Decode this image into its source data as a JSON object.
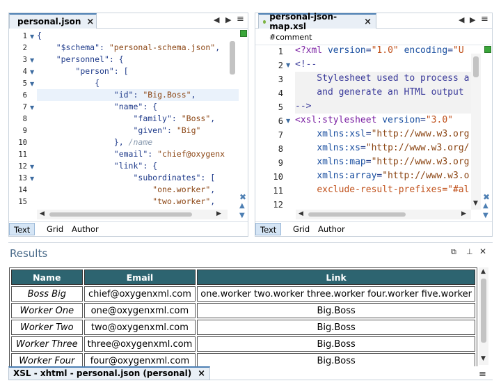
{
  "left_editor": {
    "tab_title": "personal.json",
    "close_glyph": "×",
    "nav_left": "◀",
    "nav_right": "▶",
    "menu_glyph": "≡",
    "lines": [
      {
        "n": "1",
        "fold": "▼",
        "code": [
          [
            "c-pun",
            "{"
          ]
        ]
      },
      {
        "n": "2",
        "fold": "",
        "code": [
          [
            "",
            "    "
          ],
          [
            "c-key",
            "\"$schema\""
          ],
          [
            "c-pun",
            ": "
          ],
          [
            "c-str",
            "\"personal-schema.json\""
          ],
          [
            "c-pun",
            ","
          ]
        ]
      },
      {
        "n": "3",
        "fold": "▼",
        "code": [
          [
            "",
            "    "
          ],
          [
            "c-key",
            "\"personnel\""
          ],
          [
            "c-pun",
            ": {"
          ]
        ]
      },
      {
        "n": "4",
        "fold": "▼",
        "code": [
          [
            "",
            "        "
          ],
          [
            "c-key",
            "\"person\""
          ],
          [
            "c-pun",
            ": ["
          ]
        ]
      },
      {
        "n": "5",
        "fold": "▼",
        "code": [
          [
            "",
            "            "
          ],
          [
            "c-pun",
            "{"
          ]
        ]
      },
      {
        "n": "6",
        "fold": "",
        "code": [
          [
            "",
            "                "
          ],
          [
            "c-key",
            "\"id\""
          ],
          [
            "c-pun",
            ": "
          ],
          [
            "c-str",
            "\"Big.Boss\""
          ],
          [
            "c-pun",
            ","
          ]
        ]
      },
      {
        "n": "7",
        "fold": "▼",
        "code": [
          [
            "",
            "                "
          ],
          [
            "c-key",
            "\"name\""
          ],
          [
            "c-pun",
            ": {"
          ]
        ]
      },
      {
        "n": "8",
        "fold": "",
        "code": [
          [
            "",
            "                    "
          ],
          [
            "c-key",
            "\"family\""
          ],
          [
            "c-pun",
            ": "
          ],
          [
            "c-str",
            "\"Boss\""
          ],
          [
            "c-pun",
            ","
          ]
        ]
      },
      {
        "n": "9",
        "fold": "",
        "code": [
          [
            "",
            "                    "
          ],
          [
            "c-key",
            "\"given\""
          ],
          [
            "c-pun",
            ": "
          ],
          [
            "c-str",
            "\"Big\""
          ]
        ]
      },
      {
        "n": "10",
        "fold": "",
        "code": [
          [
            "",
            "                "
          ],
          [
            "c-pun",
            "}, "
          ],
          [
            "c-dim",
            "/name"
          ]
        ]
      },
      {
        "n": "11",
        "fold": "",
        "code": [
          [
            "",
            "                "
          ],
          [
            "c-key",
            "\"email\""
          ],
          [
            "c-pun",
            ": "
          ],
          [
            "c-str",
            "\"chief@oxygenx"
          ]
        ]
      },
      {
        "n": "12",
        "fold": "▼",
        "code": [
          [
            "",
            "                "
          ],
          [
            "c-key",
            "\"link\""
          ],
          [
            "c-pun",
            ": {"
          ]
        ]
      },
      {
        "n": "13",
        "fold": "▼",
        "code": [
          [
            "",
            "                    "
          ],
          [
            "c-key",
            "\"subordinates\""
          ],
          [
            "c-pun",
            ": ["
          ]
        ]
      },
      {
        "n": "14",
        "fold": "",
        "code": [
          [
            "",
            "                        "
          ],
          [
            "c-str",
            "\"one.worker\""
          ],
          [
            "c-pun",
            ","
          ]
        ]
      },
      {
        "n": "15",
        "fold": "",
        "code": [
          [
            "",
            "                        "
          ],
          [
            "c-str",
            "\"two.worker\""
          ],
          [
            "c-pun",
            ","
          ]
        ]
      }
    ],
    "modes": [
      "Text",
      "Grid",
      "Author"
    ]
  },
  "right_editor": {
    "tab_title": "personal-json-map.xsl",
    "close_glyph": "×",
    "nav_left": "◀",
    "nav_right": "▶",
    "menu_glyph": "≡",
    "breadcrumb": "#comment",
    "lines": [
      {
        "n": "1",
        "fold": "",
        "code": [
          [
            "c-tag",
            "<?xml "
          ],
          [
            "c-att",
            "version"
          ],
          [
            "c-pun",
            "="
          ],
          [
            "c-val",
            "\"1.0\" "
          ],
          [
            "c-att",
            "encoding"
          ],
          [
            "c-pun",
            "="
          ],
          [
            "c-val",
            "\"U"
          ]
        ]
      },
      {
        "n": "2",
        "fold": "▼",
        "code": [
          [
            "c-cmt",
            "<!--"
          ]
        ]
      },
      {
        "n": "3",
        "fold": "",
        "code": [
          [
            "c-cmt",
            "    Stylesheet used to process a"
          ]
        ]
      },
      {
        "n": "4",
        "fold": "",
        "code": [
          [
            "c-cmt",
            "    and generate an HTML output "
          ]
        ]
      },
      {
        "n": "5",
        "fold": "",
        "code": [
          [
            "c-cmt",
            "-->"
          ]
        ]
      },
      {
        "n": "6",
        "fold": "▼",
        "code": [
          [
            "c-tag",
            "<xsl:stylesheet "
          ],
          [
            "c-att",
            "version"
          ],
          [
            "c-pun",
            "="
          ],
          [
            "c-val",
            "\"3.0\""
          ]
        ]
      },
      {
        "n": "7",
        "fold": "",
        "code": [
          [
            "",
            "    "
          ],
          [
            "c-att",
            "xmlns:xsl"
          ],
          [
            "c-pun",
            "="
          ],
          [
            "c-str",
            "\"http://www.w3.org"
          ]
        ]
      },
      {
        "n": "8",
        "fold": "",
        "code": [
          [
            "",
            "    "
          ],
          [
            "c-att",
            "xmlns:xs"
          ],
          [
            "c-pun",
            "="
          ],
          [
            "c-str",
            "\"http://www.w3.org/"
          ]
        ]
      },
      {
        "n": "9",
        "fold": "",
        "code": [
          [
            "",
            "    "
          ],
          [
            "c-att",
            "xmlns:map"
          ],
          [
            "c-pun",
            "="
          ],
          [
            "c-str",
            "\"http://www.w3.org"
          ]
        ]
      },
      {
        "n": "10",
        "fold": "",
        "code": [
          [
            "",
            "    "
          ],
          [
            "c-att",
            "xmlns:array"
          ],
          [
            "c-pun",
            "="
          ],
          [
            "c-str",
            "\"http://www.w3.o"
          ]
        ]
      },
      {
        "n": "11",
        "fold": "",
        "code": [
          [
            "",
            "    "
          ],
          [
            "c-val",
            "exclude-result-prefixes=\"#al"
          ]
        ]
      },
      {
        "n": "12",
        "fold": "",
        "code": []
      }
    ],
    "modes": [
      "Text",
      "Grid",
      "Author"
    ]
  },
  "results": {
    "title": "Results",
    "headers": [
      "Name",
      "Email",
      "Link"
    ],
    "rows": [
      [
        "Boss Big",
        "chief@oxygenxml.com",
        "one.worker two.worker three.worker four.worker five.worker"
      ],
      [
        "Worker One",
        "one@oxygenxml.com",
        "Big.Boss"
      ],
      [
        "Worker Two",
        "two@oxygenxml.com",
        "Big.Boss"
      ],
      [
        "Worker Three",
        "three@oxygenxml.com",
        "Big.Boss"
      ],
      [
        "Worker Four",
        "four@oxygenxml.com",
        "Big.Boss"
      ]
    ],
    "tab_label": "XSL - xhtml - personal.json (personal)",
    "tab_close": "×",
    "restore_glyph": "⧉",
    "pin_glyph": "⊥",
    "close_glyph": "✕",
    "menu_glyph": "≡"
  },
  "colors": {
    "header_bg": "#2d6470",
    "tab_accent": "#4d7fb3",
    "status_ok": "#3aa63a"
  },
  "icons": {
    "fold": "fold-triangle-icon",
    "status": "status-ok-icon",
    "diff": "compare-icon"
  }
}
